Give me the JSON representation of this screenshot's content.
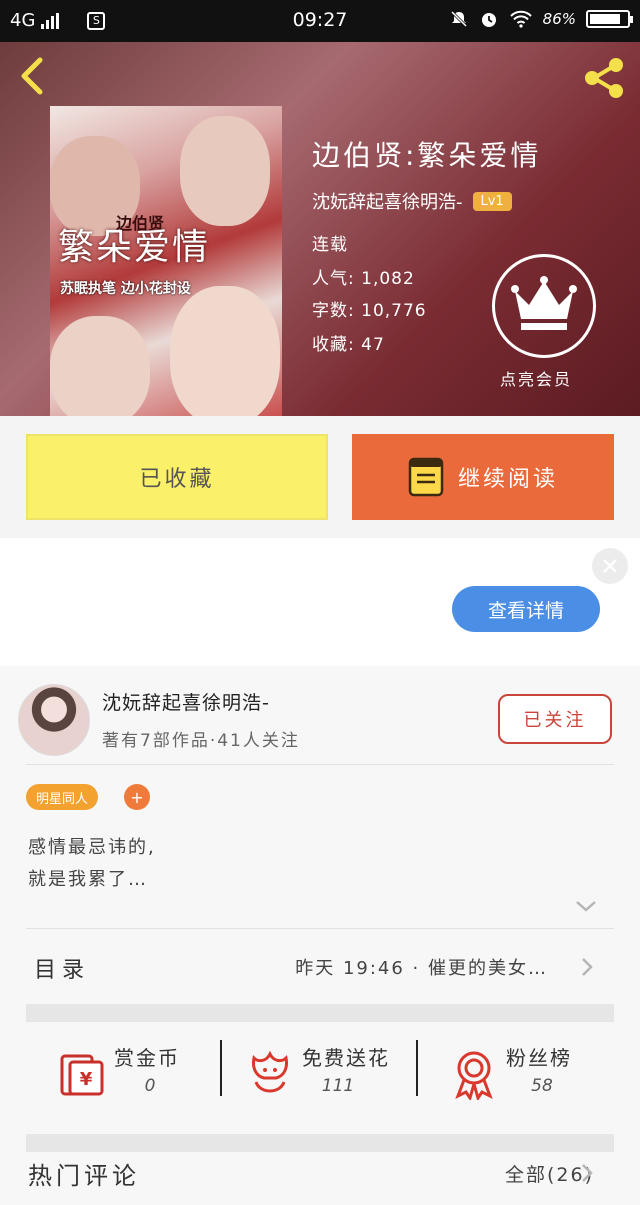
{
  "status_bar": {
    "network": "4G",
    "sim_icon": "S",
    "time": "09:27",
    "battery": "86%"
  },
  "book": {
    "title": "边伯贤:繁朵爱情",
    "author": "沈妧辞起喜徐明浩-",
    "level": "Lv1",
    "status": "连载",
    "popularity": "人气: 1,082",
    "word_count": "字数: 10,776",
    "favorites": "收藏: 47",
    "cover_title": "繁朵爱情",
    "cover_overlay": "边伯贤",
    "cover_credits": "苏眠执笔  边小花封设",
    "vip_label": "点亮会员"
  },
  "actions": {
    "favorite_label": "已收藏",
    "read_label": "继续阅读"
  },
  "details_button": "查看详情",
  "author_card": {
    "name": "沈妧辞起喜徐明浩-",
    "stats": "著有7部作品·41人关注",
    "follow_label": "已关注"
  },
  "tag": {
    "label": "明星同人",
    "add": "+"
  },
  "intro": {
    "line1": "感情最忌讳的,",
    "line2": "就是我累了…"
  },
  "toc": {
    "label": "目录",
    "latest": "昨天  19:46 · 催更的美女…"
  },
  "stats": [
    {
      "label": "赏金币",
      "value": "0",
      "icon": "red-envelope-icon"
    },
    {
      "label": "免费送花",
      "value": "111",
      "icon": "flower-icon"
    },
    {
      "label": "粉丝榜",
      "value": "58",
      "icon": "rosette-icon"
    }
  ],
  "comments": {
    "title": "热门评论",
    "all": "全部(26)"
  },
  "colors": {
    "accent_orange": "#ea6a3c",
    "fav_yellow": "#fbf06a",
    "details_blue": "#4b8ee6",
    "follow_red": "#c9443a",
    "level_badge": "#f0b040",
    "back_yellow": "#f4e04a"
  }
}
